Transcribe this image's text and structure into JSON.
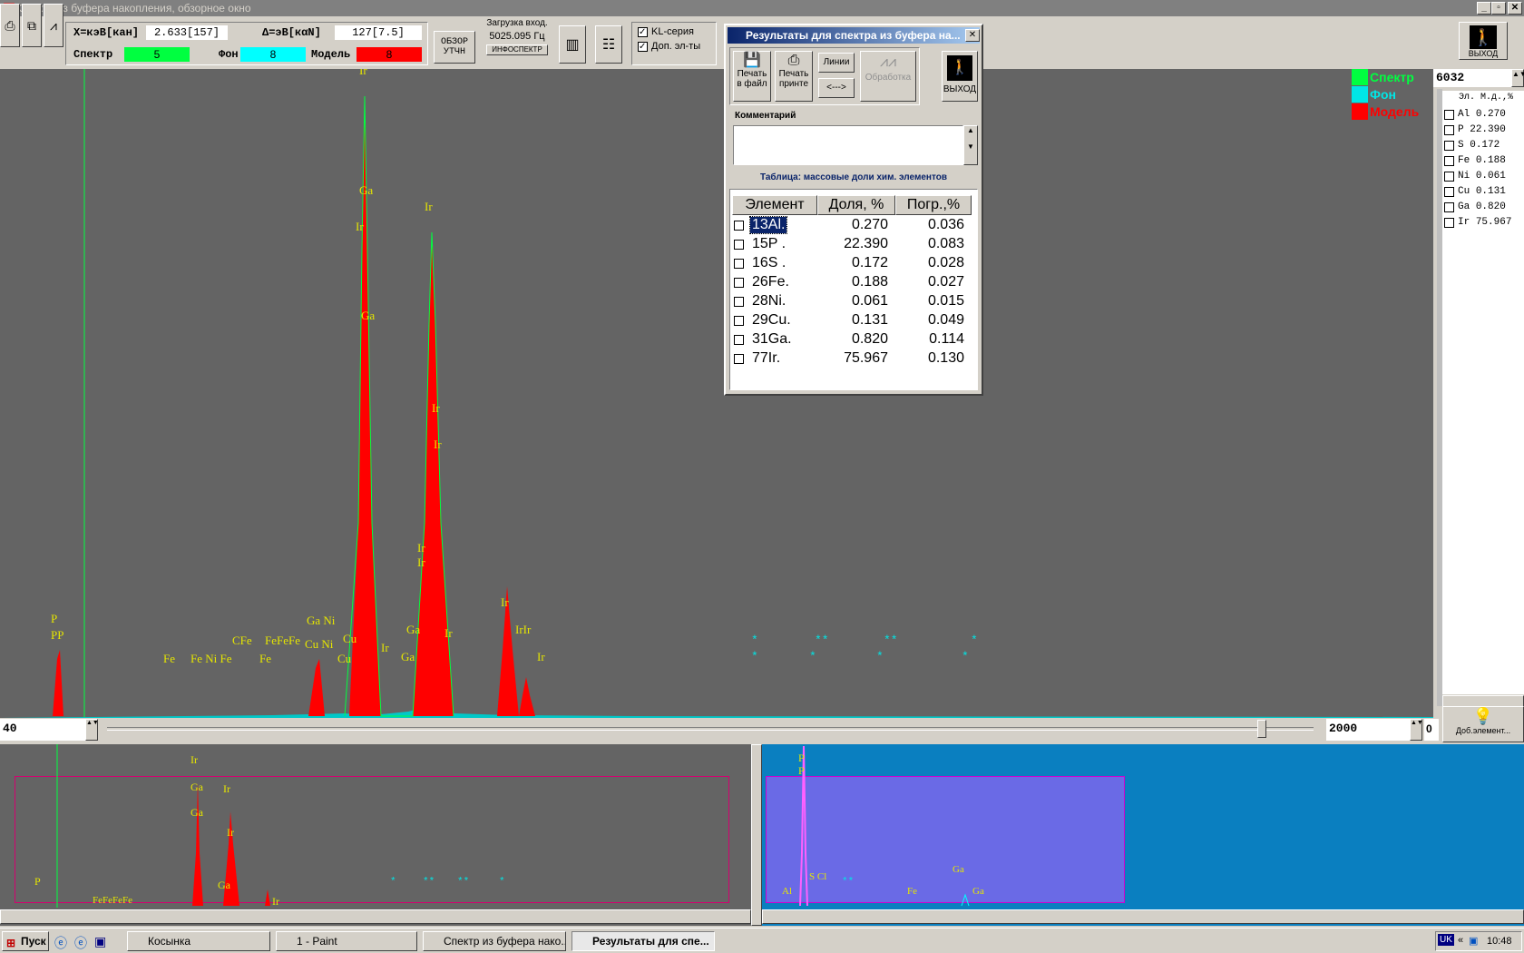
{
  "window": {
    "title": "Спектр из буфера накопления, обзорное окно"
  },
  "readout": {
    "x_label": "X=кэВ[кан]",
    "x_value": "2.633[157]",
    "d_label": "Δ=эВ[кαN]",
    "d_value": "127[7.5]",
    "spectrum_label": "Спектр",
    "spectrum_value": "5",
    "bg_label": "Фон",
    "bg_value": "8",
    "model_label": "Модель",
    "model_value": "8"
  },
  "toolbar": {
    "overview_btn": "ОБЗОР",
    "refine_btn": "УТЧН",
    "load_label": "Загрузка вход.",
    "load_value": "5025.095 Гц",
    "infospectr_btn": "ИНФОСПЕКТР",
    "kl_series": "KL-серия",
    "extra_elems": "Доп. эл-ты",
    "exit_top": "ВЫХОД"
  },
  "legend": {
    "spectrum": "Спектр",
    "background": "Фон",
    "model": "Модель"
  },
  "right_panel": {
    "counts": "6032",
    "header": "Эл. М.д.,%",
    "add_element": "Доб.элемент...",
    "items": [
      {
        "el": "Al",
        "val": "0.270"
      },
      {
        "el": "P",
        "val": "22.390"
      },
      {
        "el": "S",
        "val": "0.172"
      },
      {
        "el": "Fe",
        "val": "0.188"
      },
      {
        "el": "Ni",
        "val": "0.061"
      },
      {
        "el": "Cu",
        "val": "0.131"
      },
      {
        "el": "Ga",
        "val": "0.820"
      },
      {
        "el": "Ir",
        "val": "75.967"
      }
    ]
  },
  "slider": {
    "min": "40",
    "max": "2000",
    "right": "0"
  },
  "dialog": {
    "title": "Результаты для спектра из буфера на...",
    "print_file": "Печать в файл",
    "print_printer": "Печать принте",
    "lines": "Линии",
    "arrows": "<--->",
    "processing": "Обработка",
    "exit": "ВЫХОД",
    "comment_label": "Комментарий",
    "table_caption": "Таблица: массовые доли хим. элементов",
    "col_element": "Элемент",
    "col_share": "Доля, %",
    "col_error": "Погр.,%",
    "rows": [
      {
        "el": "13Al.",
        "share": "0.270",
        "err": "0.036"
      },
      {
        "el": "15P .",
        "share": "22.390",
        "err": "0.083"
      },
      {
        "el": "16S .",
        "share": "0.172",
        "err": "0.028"
      },
      {
        "el": "26Fe.",
        "share": "0.188",
        "err": "0.027"
      },
      {
        "el": "28Ni.",
        "share": "0.061",
        "err": "0.015"
      },
      {
        "el": "29Cu.",
        "share": "0.131",
        "err": "0.049"
      },
      {
        "el": "31Ga.",
        "share": "0.820",
        "err": "0.114"
      },
      {
        "el": "77Ir.",
        "share": "75.967",
        "err": "0.130"
      }
    ]
  },
  "plot_labels": {
    "p": "P",
    "p2": "PP",
    "fe": "Fe",
    "fe_ni": "Fe Ni Fe",
    "fe2": "Fe",
    "ni": "Ni",
    "cu": "Cu",
    "ga": "Ga",
    "ir": "Ir",
    "irir": "IrIr",
    "cecc": "CFe",
    "fe_group": "FeFeFe",
    "ga_ni": "Ga Ni",
    "cu_ni": "Cu Ni",
    "star": "*",
    "starstar": "**"
  },
  "overview": {
    "ir": "Ir",
    "ga": "Ga",
    "p": "P",
    "fe_row": "FeFeFeFe",
    "s_cl": "S Cl",
    "al": "Al",
    "ga_fe": "Ga",
    "fe": "Fe"
  },
  "taskbar": {
    "start": "Пуск",
    "tasks": [
      "Косынка",
      "1 - Paint",
      "Спектр из буфера нако...",
      "Результаты для спе..."
    ],
    "lang": "UK",
    "time": "10:48"
  },
  "colors": {
    "spectrum": "#00ff40",
    "background": "#00e6e6",
    "model": "#ff0000"
  }
}
